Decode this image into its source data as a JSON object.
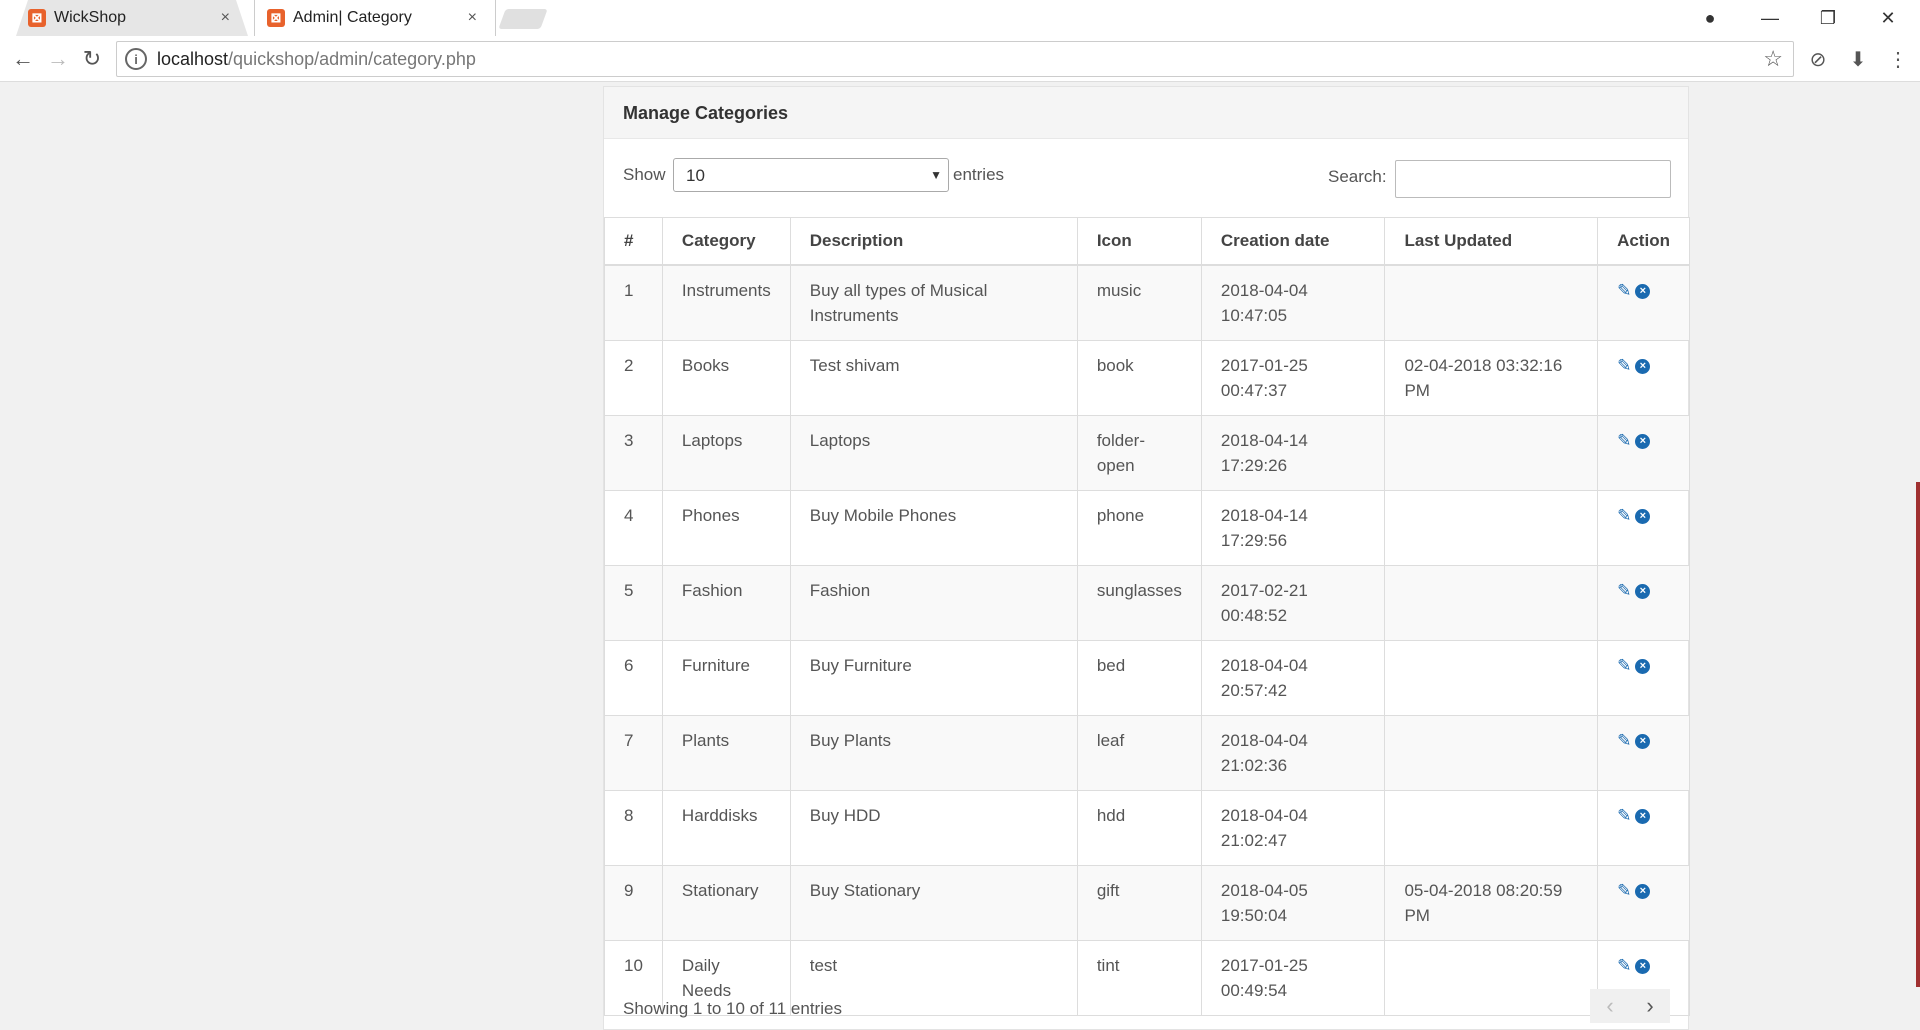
{
  "browser": {
    "tabs": [
      {
        "title": "WickShop",
        "favicon": "xampp-icon"
      },
      {
        "title": "Admin| Category",
        "favicon": "xampp-icon"
      }
    ],
    "close_glyph": "×",
    "url_host": "localhost",
    "url_path": "/quickshop/admin/category.php",
    "info_glyph": "i",
    "star_glyph": "☆",
    "back_glyph": "←",
    "forward_glyph": "→",
    "reload_glyph": "↻",
    "minimize_glyph": "—",
    "restore_glyph": "❐",
    "window_close_glyph": "✕",
    "profile_glyph": "●",
    "block_glyph": "⊘",
    "extension_glyph": "⬇",
    "menu_glyph": "⋮"
  },
  "panel": {
    "title": "Manage Categories",
    "show_label": "Show",
    "page_size": "10",
    "entries_label": "entries",
    "search_label": "Search:",
    "search_value": ""
  },
  "table": {
    "headers": [
      "#",
      "Category",
      "Description",
      "Icon",
      "Creation date",
      "Last Updated",
      "Action"
    ],
    "rows": [
      {
        "num": "1",
        "category": "Instruments",
        "description": "Buy all types of Musical Instruments",
        "icon": "music",
        "created": "2018-04-04 10:47:05",
        "updated": ""
      },
      {
        "num": "2",
        "category": "Books",
        "description": "Test shivam",
        "icon": "book",
        "created": "2017-01-25 00:47:37",
        "updated": "02-04-2018 03:32:16 PM"
      },
      {
        "num": "3",
        "category": "Laptops",
        "description": "Laptops",
        "icon": "folder-open",
        "created": "2018-04-14 17:29:26",
        "updated": ""
      },
      {
        "num": "4",
        "category": "Phones",
        "description": "Buy Mobile Phones",
        "icon": "phone",
        "created": "2018-04-14 17:29:56",
        "updated": ""
      },
      {
        "num": "5",
        "category": "Fashion",
        "description": "Fashion",
        "icon": "sunglasses",
        "created": "2017-02-21 00:48:52",
        "updated": ""
      },
      {
        "num": "6",
        "category": "Furniture",
        "description": "Buy Furniture",
        "icon": "bed",
        "created": "2018-04-04 20:57:42",
        "updated": ""
      },
      {
        "num": "7",
        "category": "Plants",
        "description": "Buy Plants",
        "icon": "leaf",
        "created": "2018-04-04 21:02:36",
        "updated": ""
      },
      {
        "num": "8",
        "category": "Harddisks",
        "description": "Buy HDD",
        "icon": "hdd",
        "created": "2018-04-04 21:02:47",
        "updated": ""
      },
      {
        "num": "9",
        "category": "Stationary",
        "description": "Buy Stationary",
        "icon": "gift",
        "created": "2018-04-05 19:50:04",
        "updated": "05-04-2018 08:20:59 PM"
      },
      {
        "num": "10",
        "category": "Daily Needs",
        "description": "test",
        "icon": "tint",
        "created": "2017-01-25 00:49:54",
        "updated": ""
      }
    ],
    "edit_glyph": "✎",
    "delete_glyph": "×"
  },
  "footer": {
    "info": "Showing 1 to 10 of 11 entries",
    "prev_glyph": "‹",
    "next_glyph": "›"
  },
  "colors": {
    "action_icon": "#1a6ab0",
    "favicon": "#e8622c",
    "scroll_thumb": "#a03030"
  }
}
